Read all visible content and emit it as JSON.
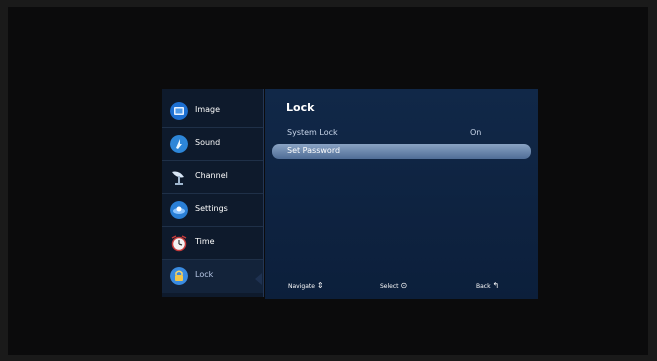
{
  "sidebar": {
    "items": [
      {
        "label": "Image",
        "icon": "image-icon"
      },
      {
        "label": "Sound",
        "icon": "sound-icon"
      },
      {
        "label": "Channel",
        "icon": "satellite-dish-icon"
      },
      {
        "label": "Settings",
        "icon": "settings-icon"
      },
      {
        "label": "Time",
        "icon": "clock-icon"
      },
      {
        "label": "Lock",
        "icon": "lock-icon"
      }
    ],
    "active": "Lock"
  },
  "panel": {
    "title": "Lock",
    "rows": [
      {
        "label": "System Lock",
        "value": "On"
      },
      {
        "label": "Set Password",
        "value": ""
      }
    ],
    "selected_row": "Set Password"
  },
  "footer": {
    "navigate": "Navigate",
    "navigate_glyph": "⇕",
    "select": "Select",
    "select_glyph": "⊙",
    "back": "Back",
    "back_glyph": "↰"
  },
  "colors": {
    "panel_bg": "#0c1f3b",
    "sidebar_bg": "#0e1a2c",
    "selection": "#6f8ab0",
    "text": "#ffffff"
  }
}
